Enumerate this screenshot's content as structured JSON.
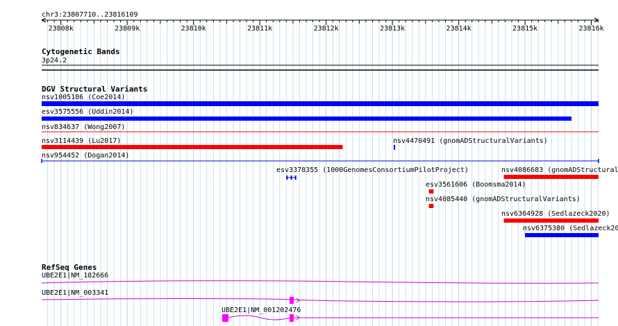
{
  "locus": "chr3:23807710..23816109",
  "colors": {
    "grid": "#add8e6",
    "dgv_blue": "#0000ff",
    "dgv_red": "#ff0000",
    "gene_magenta": "#ff00ff",
    "gene_line": "#cc00cc"
  },
  "ruler": {
    "ticks": [
      {
        "label": "23808k",
        "pos": 23808000
      },
      {
        "label": "23809k",
        "pos": 23809000
      },
      {
        "label": "23810k",
        "pos": 23810000
      },
      {
        "label": "23811k",
        "pos": 23811000
      },
      {
        "label": "23812k",
        "pos": 23812000
      },
      {
        "label": "23813k",
        "pos": 23813000
      },
      {
        "label": "23814k",
        "pos": 23814000
      },
      {
        "label": "23815k",
        "pos": 23815000
      },
      {
        "label": "23816k",
        "pos": 23816000
      }
    ]
  },
  "cytobands": {
    "title": "Cytogenetic Bands",
    "band": "3p24.2"
  },
  "dgv": {
    "title": "DGV Structural Variants",
    "items": [
      {
        "label": "nsv1005186 (Coe2014)",
        "color": "blue",
        "start": 23807710,
        "end": 23816109,
        "style": "bar"
      },
      {
        "label": "esv3575556 (Uddin2014)",
        "color": "blue",
        "start": 23807710,
        "end": 23815700,
        "style": "bar"
      },
      {
        "label": "nsv834637 (Wong2007)",
        "color": "red",
        "start": 23807710,
        "end": 23816109,
        "style": "line"
      },
      {
        "label": "nsv3114439 (Lu2017)",
        "color": "red",
        "start": 23807710,
        "end": 23812250,
        "style": "bar"
      },
      {
        "label": "nsv4470491 (gnomADStructuralVariants)",
        "color": "blue",
        "start": 23813020,
        "end": 23813040,
        "style": "tick"
      },
      {
        "label": "nsv954452 (Dogan2014)",
        "color": "blue",
        "start": 23807710,
        "end": 23816109,
        "style": "line"
      },
      {
        "label": "esv3378355 (1000GenomesConsortiumPilotProject)",
        "color": "blue",
        "start": 23811400,
        "end": 23811550,
        "style": "double-tick"
      },
      {
        "label": "nsv4086683 (gnomADStructural",
        "color": "red",
        "start": 23814680,
        "end": 23816109,
        "style": "bar"
      },
      {
        "label": "esv3561606 (Boomsma2014)",
        "color": "red",
        "start": 23813550,
        "end": 23813620,
        "style": "bar"
      },
      {
        "label": "nsv4085440 (gnomADStructuralVariants)",
        "color": "red",
        "start": 23813550,
        "end": 23813620,
        "style": "bar"
      },
      {
        "label": "nsv6364928 (Sedlazeck2020)",
        "color": "red",
        "start": 23814680,
        "end": 23816109,
        "style": "bar"
      },
      {
        "label": "nsv6375380 (Sedlazeck20",
        "color": "blue",
        "start": 23815000,
        "end": 23816109,
        "style": "bar"
      }
    ]
  },
  "refseq": {
    "title": "RefSeq Genes",
    "genes": [
      {
        "label": "UBE2E1|NM_182666"
      },
      {
        "label": "UBE2E1|NM_003341"
      },
      {
        "label": "UBE2E1|NM_001202476"
      }
    ]
  }
}
